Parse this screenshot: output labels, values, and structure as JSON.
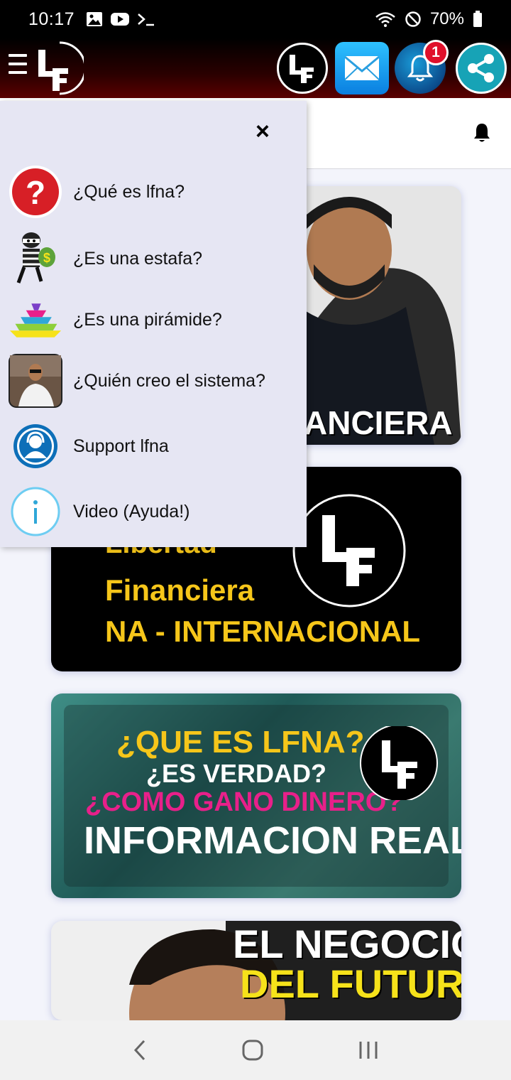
{
  "status_bar": {
    "time": "10:17",
    "battery": "70%",
    "icons": [
      "gallery-icon",
      "youtube-icon",
      "terminal-icon",
      "wifi-icon",
      "do-not-disturb-icon",
      "battery-icon"
    ]
  },
  "app_bar": {
    "brand": "LF",
    "notification_count": "1",
    "icons": [
      "menu-icon",
      "lf-logo-icon",
      "mail-icon",
      "bell-icon",
      "share-icon"
    ]
  },
  "drawer": {
    "close_glyph": "×",
    "items": [
      {
        "label": "¿Qué es lfna?",
        "icon": "question-icon"
      },
      {
        "label": "¿Es una estafa?",
        "icon": "thief-icon"
      },
      {
        "label": "¿Es una pirámide?",
        "icon": "pyramid-icon"
      },
      {
        "label": "¿Quién creo el sistema?",
        "icon": "founder-avatar"
      },
      {
        "label": "Support lfna",
        "icon": "support-agent-icon"
      },
      {
        "label": "Video (Ayuda!)",
        "icon": "info-icon"
      }
    ]
  },
  "cards": {
    "card1": {
      "text": "ANCIERA"
    },
    "card2": {
      "line1": "Libertad",
      "line2": "Financiera",
      "line3": "NA - INTERNACIONAL",
      "logo": "LF"
    },
    "card3": {
      "line1": "¿QUE ES LFNA?",
      "line2": "¿ES VERDAD?",
      "line3": "¿COMO GANO DINERO?",
      "line4": "INFORMACION REAL",
      "logo": "LF"
    },
    "card4": {
      "line1": "EL NEGOCIO",
      "line2": "DEL FUTURO"
    }
  },
  "colors": {
    "accent_yellow": "#f6c61a",
    "accent_pink": "#e8208a",
    "badge_red": "#e0102b",
    "drawer_bg": "#e6e6f3"
  },
  "nav_bar": {
    "icons": [
      "back-icon",
      "home-icon",
      "recents-icon"
    ]
  }
}
